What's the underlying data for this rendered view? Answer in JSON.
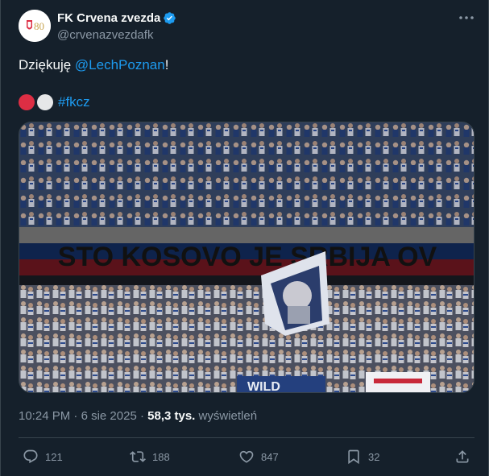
{
  "account": {
    "display_name": "FK Crvena zvezda",
    "handle": "@crvenazvezdafk",
    "avatar_text": "80"
  },
  "tweet": {
    "text_prefix": "Dziękuję ",
    "mention": "@LechPoznan",
    "text_suffix": "!",
    "hashtag": "#fkcz"
  },
  "media": {
    "banner_text": "STO KOSOVO JE SRBIJA OV",
    "flag_text": "WILD"
  },
  "meta": {
    "time": "10:24 PM",
    "separator": " · ",
    "date": "6 sie 2025",
    "views_count": "58,3 tys.",
    "views_label": " wyświetleń"
  },
  "actions": {
    "replies": "121",
    "reposts": "188",
    "likes": "847",
    "bookmarks": "32"
  },
  "icons": {
    "verified": "verified-badge-icon",
    "more": "more-icon",
    "reply": "reply-icon",
    "repost": "repost-icon",
    "like": "heart-icon",
    "bookmark": "bookmark-icon",
    "share": "share-icon"
  },
  "colors": {
    "background": "#15202b",
    "accent": "#1d9bf0",
    "muted": "#8b98a5",
    "border": "#38444d"
  }
}
